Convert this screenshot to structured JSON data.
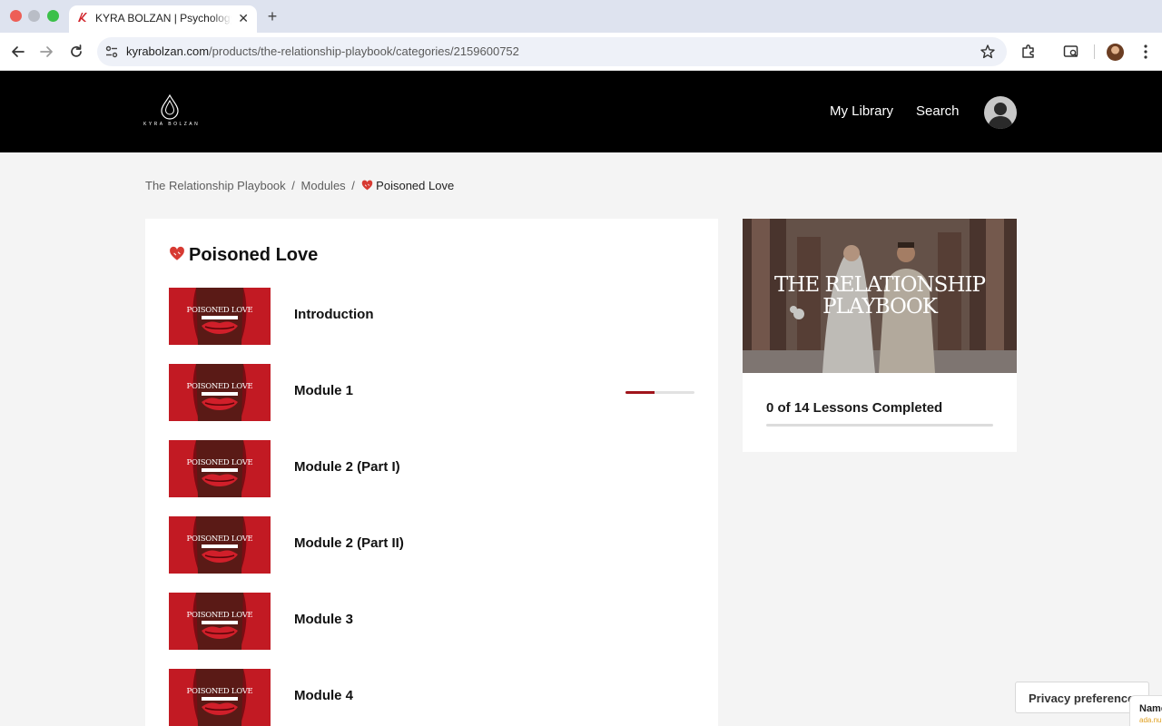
{
  "browser": {
    "tab_title": "KYRA BOLZAN | Psychology S",
    "tab_close": "✕",
    "new_tab": "+",
    "url_host": "kyrabolzan.com",
    "url_path": "/products/the-relationship-playbook/categories/2159600752"
  },
  "header": {
    "logo_text": "KYRA BOLZAN",
    "nav": [
      "My Library",
      "Search"
    ]
  },
  "breadcrumb": {
    "course": "The Relationship Playbook",
    "section": "Modules",
    "current": "Poisoned Love",
    "separator": "/"
  },
  "module": {
    "title": "Poisoned Love",
    "thumbnail_text": "POISONED LOVE",
    "lessons": [
      {
        "label": "Introduction",
        "progress": null
      },
      {
        "label": "Module 1",
        "progress": 0.42
      },
      {
        "label": "Module 2 (Part I)",
        "progress": null
      },
      {
        "label": "Module 2 (Part II)",
        "progress": null
      },
      {
        "label": "Module 3",
        "progress": null
      },
      {
        "label": "Module 4",
        "progress": null
      }
    ]
  },
  "course": {
    "cover_title": "THE RELATIONSHIP PLAYBOOK",
    "completed_text": "0 of 14 Lessons Completed",
    "completed_progress": 0
  },
  "privacy": {
    "label": "Privacy preferences",
    "widget_name": "Name",
    "widget_sub": "ada.nu"
  },
  "colors": {
    "accent": "#a0141b",
    "header_bg": "#000000",
    "page_bg": "#f4f4f4"
  }
}
